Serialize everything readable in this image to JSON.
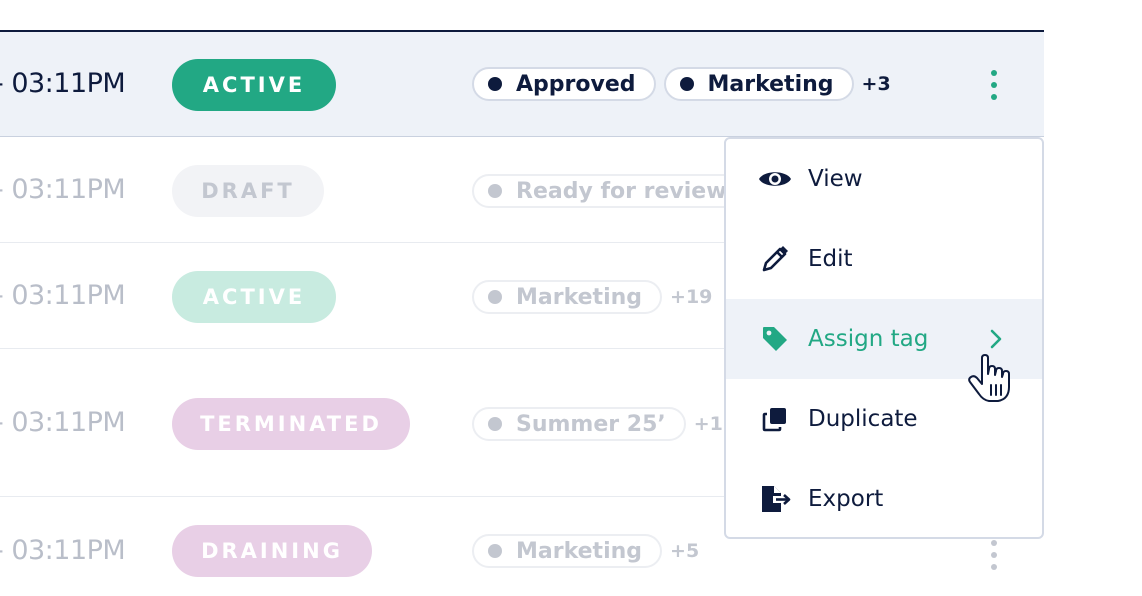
{
  "rows": [
    {
      "time": "- 03:11PM",
      "status": "ACTIVE",
      "tags": [
        "Approved",
        "Marketing"
      ],
      "more": "+3"
    },
    {
      "time": "- 03:11PM",
      "status": "DRAFT",
      "tags": [
        "Ready for review"
      ],
      "more": ""
    },
    {
      "time": "- 03:11PM",
      "status": "ACTIVE",
      "tags": [
        "Marketing"
      ],
      "more": "+19"
    },
    {
      "time": "- 03:11PM",
      "status": "TERMINATED",
      "tags": [
        "Summer 25’"
      ],
      "more": "+1"
    },
    {
      "time": "- 03:11PM",
      "status": "DRAINING",
      "tags": [
        "Marketing"
      ],
      "more": "+5"
    }
  ],
  "menu": {
    "items": [
      {
        "label": "View",
        "icon": "eye-icon"
      },
      {
        "label": "Edit",
        "icon": "pencil-icon"
      },
      {
        "label": "Assign tag",
        "icon": "tag-icon",
        "hovered": true
      },
      {
        "label": "Duplicate",
        "icon": "duplicate-icon"
      },
      {
        "label": "Export",
        "icon": "export-icon"
      }
    ]
  },
  "colors": {
    "accent": "#22a884",
    "text": "#0e1b3d",
    "row_highlight": "#eef2f8",
    "terminated": "#e8cfe6",
    "draft": "#f2f3f6"
  }
}
